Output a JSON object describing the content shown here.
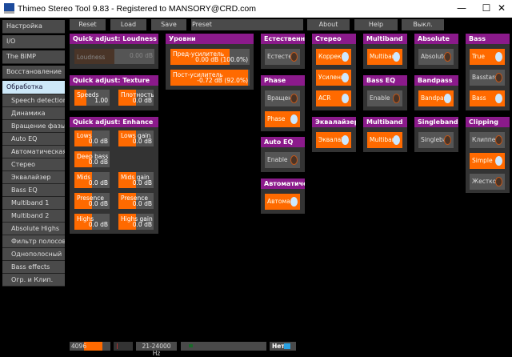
{
  "window": {
    "title": "Thimeo Stereo Tool 9.83 - Registered to MANSORY@CRD.com"
  },
  "sidebar": {
    "items": [
      "Настройка",
      "I/O",
      "The BIMP",
      "Восстановление",
      "Обработка"
    ],
    "sub_items": [
      "Speech detection",
      "Динамика",
      "Вращение фазы",
      "Auto EQ",
      "Автоматическая",
      "Стерео",
      "Эквалайзер",
      "Bass EQ",
      "Multiband 1",
      "Multiband 2",
      "Absolute Highs",
      "Фильтр полосовой",
      "Однополосный",
      "Bass effects",
      "Огр. и Клип."
    ],
    "selected": "Обработка"
  },
  "toolbar": {
    "reset": "Reset",
    "load": "Load",
    "save": "Save",
    "preset": "Preset",
    "about": "About",
    "help": "Help",
    "off": "Выкл."
  },
  "loudness": {
    "title": "Quick adjust: Loudness",
    "label": "Loudness",
    "value": "0.00 dB",
    "fill": 50
  },
  "texture": {
    "title": "Quick adjust: Texture",
    "speeds": {
      "label": "Speeds",
      "value": "1.00",
      "fill": 35
    },
    "density": {
      "label": "Плотность",
      "value": "0.0 dB",
      "fill": 50
    }
  },
  "enhance": {
    "title": "Quick adjust: Enhance",
    "sliders": [
      {
        "label": "Lows",
        "value": "0.0 dB",
        "fill": 50
      },
      {
        "label": "Lows gain",
        "value": "0.0 dB",
        "fill": 50
      },
      {
        "label": "Deep bass",
        "value": "0.0 dB",
        "fill": 50
      },
      null,
      {
        "label": "Mids",
        "value": "0.0 dB",
        "fill": 50
      },
      {
        "label": "Mids gain",
        "value": "0.0 dB",
        "fill": 50
      },
      {
        "label": "Presence",
        "value": "0.0 dB",
        "fill": 50
      },
      {
        "label": "Presence",
        "value": "0.0 dB",
        "fill": 50
      },
      {
        "label": "Highs",
        "value": "0.0 dB",
        "fill": 50
      },
      {
        "label": "Highs gain",
        "value": "0.0 dB",
        "fill": 50
      }
    ]
  },
  "levels": {
    "title": "Уровни",
    "pre": {
      "label": "Пред-усилитель",
      "value": "0.00 dB (100.0%)",
      "fill": 75
    },
    "post": {
      "label": "Пост-усилитель",
      "value": "-0.72 dB (92.0%)",
      "fill": 98
    }
  },
  "toggle_panels": [
    {
      "title": "Естественна",
      "toggles": [
        {
          "label": "Естесте",
          "on": false
        }
      ]
    },
    {
      "title": "Phase",
      "toggles": [
        {
          "label": "Вращен",
          "on": false
        },
        {
          "label": "Phase",
          "on": true
        }
      ]
    },
    {
      "title": "Auto EQ",
      "toggles": [
        {
          "label": "Enable",
          "on": false
        }
      ]
    },
    {
      "title": "Автоматиче",
      "toggles": [
        {
          "label": "Автома",
          "on": true
        }
      ]
    },
    {
      "title": "Стерео",
      "toggles": [
        {
          "label": "Коррекц",
          "on": true
        },
        {
          "label": "Усилени",
          "on": true
        },
        {
          "label": "ACR",
          "on": true
        }
      ]
    },
    {
      "title": "Эквалайзер",
      "toggles": [
        {
          "label": "Эквалаі",
          "on": true
        }
      ]
    },
    {
      "title": "Multiband",
      "toggles": [
        {
          "label": "Multiban",
          "on": true
        }
      ]
    },
    {
      "title": "Bass EQ",
      "toggles": [
        {
          "label": "Enable",
          "on": false
        }
      ]
    },
    {
      "title": "Multiband",
      "toggles": [
        {
          "label": "Multiban",
          "on": true
        }
      ]
    },
    {
      "title": "Absolute",
      "toggles": [
        {
          "label": "Absolute",
          "on": false
        }
      ]
    },
    {
      "title": "Bandpass",
      "toggles": [
        {
          "label": "Bandpas",
          "on": true
        }
      ]
    },
    {
      "title": "Singleband",
      "toggles": [
        {
          "label": "Singleba",
          "on": false
        }
      ]
    },
    {
      "title": "Bass",
      "toggles": [
        {
          "label": "True",
          "on": true
        },
        {
          "label": "Basstarc",
          "on": false
        },
        {
          "label": "Bass",
          "on": true
        }
      ]
    },
    {
      "title": "Clipping",
      "toggles": [
        {
          "label": "Клиппер",
          "on": false
        },
        {
          "label": "Simple",
          "on": true
        },
        {
          "label": "Жестко",
          "on": false
        }
      ]
    }
  ],
  "statusbar": {
    "block": "4096",
    "block_fill": 45,
    "range": "21-24000 Hz",
    "no": "Нет"
  },
  "colors": {
    "accent": "#ff6a00",
    "header": "#8b1a8b",
    "selected": "#cde8f8"
  }
}
